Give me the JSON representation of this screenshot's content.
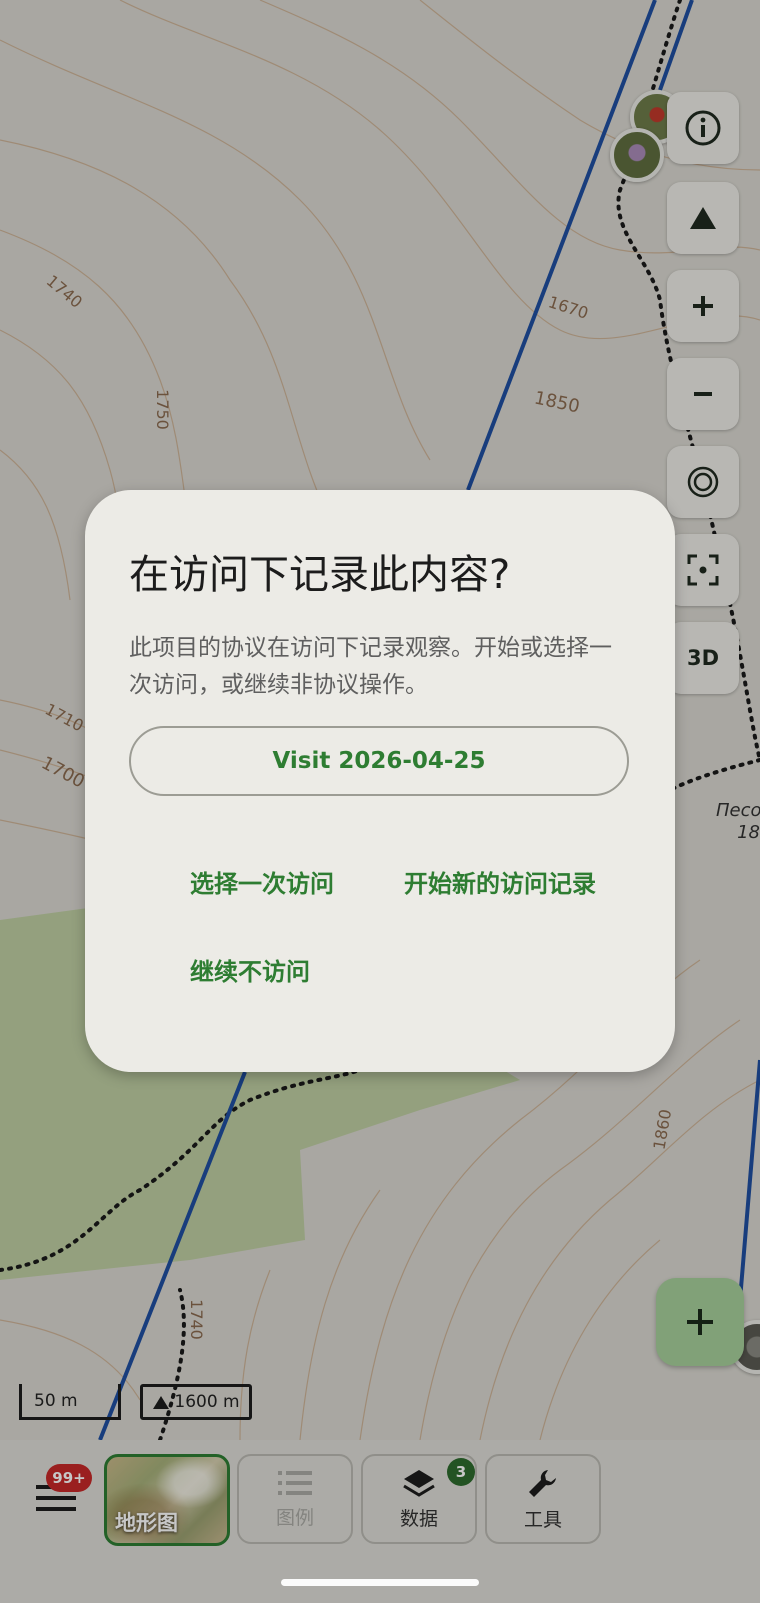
{
  "map": {
    "contour_labels": [
      "1740",
      "1750",
      "1670",
      "1850",
      "1710",
      "1700",
      "1860",
      "1740"
    ],
    "place_label_line1": "Песо",
    "place_label_line2": "18",
    "scale_label": "50 m",
    "elevation_label": "1600 m"
  },
  "controls": {
    "three_d_label": "3D"
  },
  "dialog": {
    "title": "在访问下记录此内容?",
    "body": "此项目的协议在访问下记录观察。开始或选择一次访问，或继续非协议操作。",
    "visit_button": "Visit 2026-04-25",
    "select_visit": "选择一次访问",
    "start_new_visit": "开始新的访问记录",
    "continue_without_visit": "继续不访问"
  },
  "bottom_nav": {
    "menu_badge": "99+",
    "terrain_label": "地形图",
    "legend_label": "图例",
    "data_label": "数据",
    "data_badge": "3",
    "tools_label": "工具"
  },
  "colors": {
    "accent_green": "#2e7d32",
    "badge_red": "#c62828",
    "route_blue": "#1f4fa0",
    "fab_green": "#a6cf9a"
  }
}
